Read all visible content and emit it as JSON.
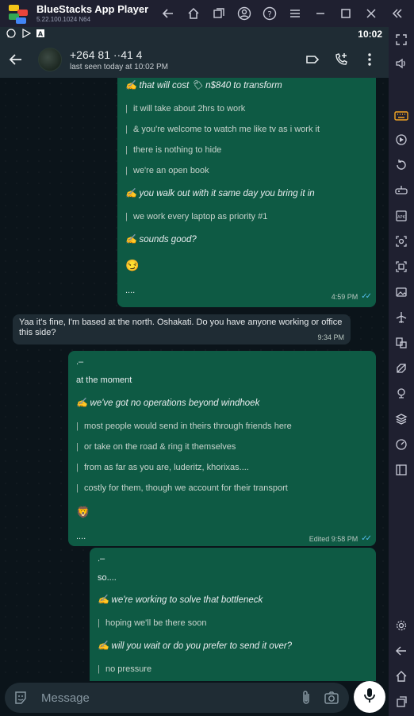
{
  "app": {
    "title": "BlueStacks App Player",
    "version": "5.22.100.1024  N64",
    "status_time": "10:02"
  },
  "contact": {
    "number": "+264 81 ··41 4",
    "last_seen": "last seen today at 10:02 PM"
  },
  "messages": [
    {
      "type": "outgoing",
      "lines": [
        {
          "kind": "highlight",
          "text": "✍ that will cost 🏷 n$840 to transform"
        },
        {
          "kind": "quote",
          "text": "it will take about 2hrs to work"
        },
        {
          "kind": "quote",
          "text": "& you're welcome to watch me like tv as i work it"
        },
        {
          "kind": "quote",
          "text": "there is nothing to hide"
        },
        {
          "kind": "quote",
          "text": "we're an open book"
        },
        {
          "kind": "highlight",
          "text": "✍ you walk out with it same day you bring it in"
        },
        {
          "kind": "quote",
          "text": "we work every laptop as priority #1"
        },
        {
          "kind": "highlight",
          "text": "✍ sounds good?"
        },
        {
          "kind": "emoji",
          "text": "😏"
        },
        {
          "kind": "plain",
          "text": "...."
        }
      ],
      "time": "4:59 PM"
    },
    {
      "type": "incoming",
      "text": "Yaa it's fine, I'm based at the north.  Oshakati.  Do you have anyone working or office this side?",
      "time": "9:34 PM"
    },
    {
      "type": "outgoing",
      "lines": [
        {
          "kind": "plain",
          "text": ".–"
        },
        {
          "kind": "plain",
          "text": "at the moment"
        },
        {
          "kind": "highlight",
          "text": "✍ we've got no operations beyond windhoek"
        },
        {
          "kind": "quote",
          "text": "most people would send in theirs through friends here"
        },
        {
          "kind": "quote",
          "text": "or take on the road & ring it themselves"
        },
        {
          "kind": "quote",
          "text": "from as far as you are, luderitz, khorixas...."
        },
        {
          "kind": "quote",
          "text": "costly for them, though we account for their transport"
        },
        {
          "kind": "emoji",
          "text": "🦁"
        },
        {
          "kind": "plain",
          "text": "...."
        }
      ],
      "time": "Edited 9:58 PM"
    },
    {
      "type": "outgoing",
      "lines": [
        {
          "kind": "plain",
          "text": ".–"
        },
        {
          "kind": "plain",
          "text": "so...."
        },
        {
          "kind": "highlight",
          "text": "✍ we're working to solve that bottleneck"
        },
        {
          "kind": "quote",
          "text": "hoping we'll be there soon"
        },
        {
          "kind": "highlight",
          "text": "✍ will you wait or do you prefer to send it over?"
        },
        {
          "kind": "quote",
          "text": "no pressure"
        }
      ]
    }
  ],
  "input": {
    "placeholder": "Message"
  },
  "colors": {
    "outgoing_bubble": "#0e5a44",
    "incoming_bubble": "#1f2c34",
    "header": "#1f2c34",
    "read_ticks": "#53bdeb"
  },
  "icons": {
    "titlebar": [
      "back-arrow-icon",
      "home-icon",
      "multi-instance-icon",
      "account-icon",
      "help-icon",
      "menu-icon",
      "minimize-icon",
      "maximize-icon",
      "close-icon",
      "collapse-sidebar-icon"
    ],
    "sidebar": [
      "fullscreen-icon",
      "volume-icon",
      "keyboard-controls-icon",
      "macro-icon",
      "rotate-icon",
      "install-apk-icon",
      "screenshot-icon",
      "screen-record-icon",
      "media-folder-icon",
      "airplane-icon",
      "multi-window-icon",
      "eco-mode-icon",
      "location-icon",
      "layers-icon",
      "performance-icon",
      "split-view-icon",
      "settings-icon",
      "android-back-icon",
      "android-home-icon",
      "recents-icon"
    ]
  }
}
